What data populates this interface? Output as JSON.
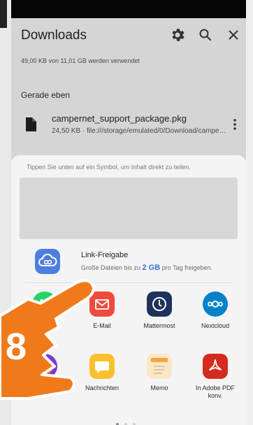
{
  "header": {
    "title": "Downloads",
    "storage_text": "49,00 KB von 11,01 GB werden verwendet",
    "section_label": "Gerade eben"
  },
  "file": {
    "name": "campernet_support_package.pkg",
    "meta": "24,50 KB · file:///storage/emulated/0/Download/campernet_support_package.pkg"
  },
  "share": {
    "hint": "Tippen Sie unten auf ein Symbol, um Inhalt direkt zu teilen.",
    "link_title": "Link-Freigabe",
    "link_sub_before": "Große Dateien bis zu ",
    "link_sub_highlight": "2 GB",
    "link_sub_after": " pro Tag freigeben.",
    "apps_row1": [
      "WhatsApp",
      "E-Mail",
      "Mattermost",
      "Nextcloud"
    ],
    "apps_row2": [
      "Firefox",
      "Nachrichten",
      "Memo",
      "In Adobe PDF konv."
    ]
  },
  "overlay": {
    "step_number": "8"
  },
  "colors": {
    "header_bg": "#d5d5d5",
    "sheet_bg": "#f4f4f4",
    "accent_blue": "#3b6fd4",
    "step_orange": "#f07a1a"
  },
  "icons": [
    "settings-gear-icon",
    "search-icon",
    "close-icon",
    "file-icon",
    "more-vert-icon",
    "cloud-link-icon",
    "whatsapp-icon",
    "email-icon",
    "mattermost-icon",
    "nextcloud-icon",
    "firefox-icon",
    "messages-icon",
    "memo-icon",
    "adobe-pdf-icon",
    "hand-pointer-icon"
  ]
}
